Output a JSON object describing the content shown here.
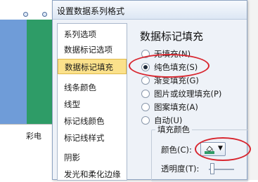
{
  "chart": {
    "category_label": "彩电",
    "colors": {
      "bar_blue": "#6f9cd8",
      "bar_green": "#2e9c67"
    }
  },
  "dialog": {
    "title": "设置数据系列格式",
    "nav_items": [
      {
        "label": "系列选项",
        "selected": false
      },
      {
        "label": "数据标记选项",
        "selected": false
      },
      {
        "label": "数据标记填充",
        "selected": true
      },
      {
        "label": "线条颜色",
        "selected": false
      },
      {
        "label": "线型",
        "selected": false
      },
      {
        "label": "标记线颜色",
        "selected": false
      },
      {
        "label": "标记线样式",
        "selected": false
      },
      {
        "label": "阴影",
        "selected": false
      },
      {
        "label": "发光和柔化边缘",
        "selected": false
      }
    ],
    "panel": {
      "title": "数据标记填充",
      "options": [
        {
          "label": "无填充(N)",
          "checked": false
        },
        {
          "label": "纯色填充(S)",
          "checked": true
        },
        {
          "label": "渐变填充(G)",
          "checked": false
        },
        {
          "label": "图片或纹理填充(P)",
          "checked": false
        },
        {
          "label": "图案填充(A)",
          "checked": false
        },
        {
          "label": "自动(U)",
          "checked": false
        }
      ],
      "fill_group_title": "填充颜色",
      "color_label": "颜色(C):",
      "transparency_label": "透明度(T):",
      "color_swatch": "#2e9c67",
      "color_icon": "paint-bucket-icon"
    }
  },
  "annotation_color": "#d8262f"
}
